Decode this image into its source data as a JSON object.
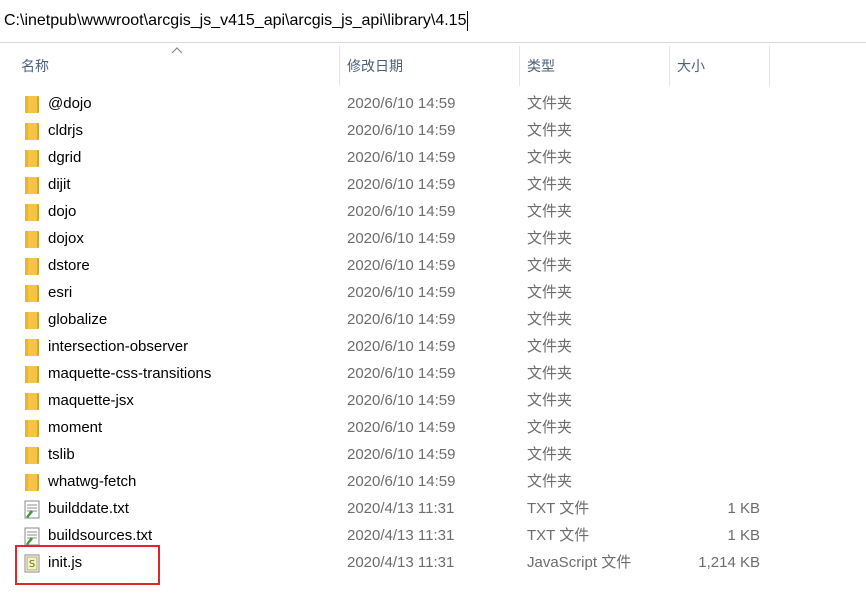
{
  "address_bar": {
    "path": "C:\\inetpub\\wwwroot\\arcgis_js_v415_api\\arcgis_js_api\\library\\4.15"
  },
  "columns": {
    "name": "名称",
    "date": "修改日期",
    "type": "类型",
    "size": "大小"
  },
  "rows": [
    {
      "name": "@dojo",
      "date": "2020/6/10 14:59",
      "type": "文件夹",
      "size": "",
      "icon": "folder-icon"
    },
    {
      "name": "cldrjs",
      "date": "2020/6/10 14:59",
      "type": "文件夹",
      "size": "",
      "icon": "folder-icon"
    },
    {
      "name": "dgrid",
      "date": "2020/6/10 14:59",
      "type": "文件夹",
      "size": "",
      "icon": "folder-icon"
    },
    {
      "name": "dijit",
      "date": "2020/6/10 14:59",
      "type": "文件夹",
      "size": "",
      "icon": "folder-icon"
    },
    {
      "name": "dojo",
      "date": "2020/6/10 14:59",
      "type": "文件夹",
      "size": "",
      "icon": "folder-icon"
    },
    {
      "name": "dojox",
      "date": "2020/6/10 14:59",
      "type": "文件夹",
      "size": "",
      "icon": "folder-icon"
    },
    {
      "name": "dstore",
      "date": "2020/6/10 14:59",
      "type": "文件夹",
      "size": "",
      "icon": "folder-icon"
    },
    {
      "name": "esri",
      "date": "2020/6/10 14:59",
      "type": "文件夹",
      "size": "",
      "icon": "folder-icon"
    },
    {
      "name": "globalize",
      "date": "2020/6/10 14:59",
      "type": "文件夹",
      "size": "",
      "icon": "folder-icon"
    },
    {
      "name": "intersection-observer",
      "date": "2020/6/10 14:59",
      "type": "文件夹",
      "size": "",
      "icon": "folder-icon"
    },
    {
      "name": "maquette-css-transitions",
      "date": "2020/6/10 14:59",
      "type": "文件夹",
      "size": "",
      "icon": "folder-icon"
    },
    {
      "name": "maquette-jsx",
      "date": "2020/6/10 14:59",
      "type": "文件夹",
      "size": "",
      "icon": "folder-icon"
    },
    {
      "name": "moment",
      "date": "2020/6/10 14:59",
      "type": "文件夹",
      "size": "",
      "icon": "folder-icon"
    },
    {
      "name": "tslib",
      "date": "2020/6/10 14:59",
      "type": "文件夹",
      "size": "",
      "icon": "folder-icon"
    },
    {
      "name": "whatwg-fetch",
      "date": "2020/6/10 14:59",
      "type": "文件夹",
      "size": "",
      "icon": "folder-icon"
    },
    {
      "name": "builddate.txt",
      "date": "2020/4/13 11:31",
      "type": "TXT 文件",
      "size": "1 KB",
      "icon": "text-file-icon"
    },
    {
      "name": "buildsources.txt",
      "date": "2020/4/13 11:31",
      "type": "TXT 文件",
      "size": "1 KB",
      "icon": "text-file-icon"
    },
    {
      "name": "init.js",
      "date": "2020/4/13 11:31",
      "type": "JavaScript 文件",
      "size": "1,214 KB",
      "icon": "js-file-icon"
    }
  ],
  "colors": {
    "header_text": "#4c607a",
    "secondary_text": "#6d6d6d",
    "folder": "#f5c445",
    "highlight": "#e0262b"
  }
}
